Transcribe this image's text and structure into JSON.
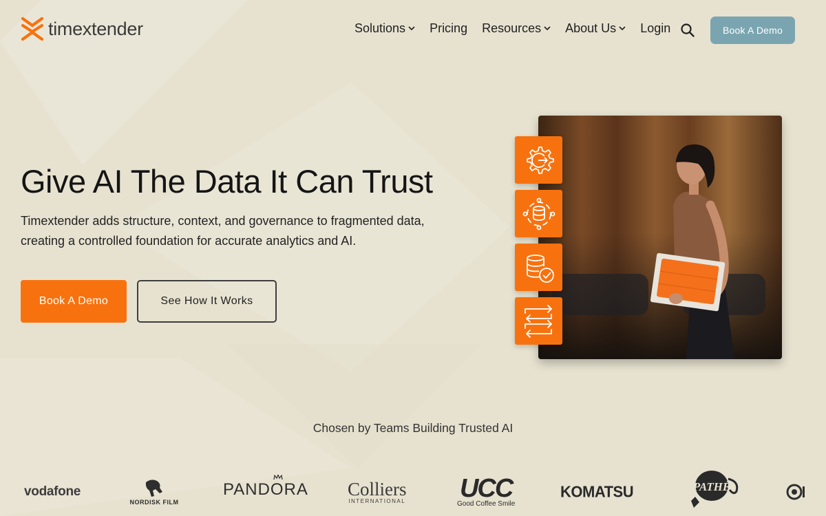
{
  "brand": {
    "logo_text": "timextender",
    "accent": "#f7720f",
    "secondary_button": "#7aa5b0"
  },
  "nav": {
    "items": [
      {
        "label": "Solutions",
        "dropdown": true
      },
      {
        "label": "Pricing",
        "dropdown": false
      },
      {
        "label": "Resources",
        "dropdown": true
      },
      {
        "label": "About Us",
        "dropdown": true
      },
      {
        "label": "Login",
        "dropdown": false
      }
    ],
    "search_icon": "search-icon",
    "cta_label": "Book A Demo"
  },
  "hero": {
    "title": "Give AI The Data It Can Trust",
    "subtitle_line1": "Timextender adds structure, context, and governance to fragmented data,",
    "subtitle_line2": "creating a controlled foundation for accurate analytics and AI.",
    "primary_label": "Book A Demo",
    "secondary_label": "See How It Works"
  },
  "feature_icons": [
    "gear-arrow-icon",
    "database-circle-icon",
    "database-check-icon",
    "swap-arrows-icon"
  ],
  "trusted": {
    "heading": "Chosen by Teams Building Trusted AI",
    "logos": [
      {
        "name": "vodafone",
        "text": "vodafone"
      },
      {
        "name": "nordisk-film",
        "text": "NORDISK FILM"
      },
      {
        "name": "pandora",
        "text": "PANDORA"
      },
      {
        "name": "colliers",
        "text": "Colliers",
        "sub": "INTERNATIONAL"
      },
      {
        "name": "ucc",
        "text": "UCC",
        "sub": "Good Coffee Smile"
      },
      {
        "name": "komatsu",
        "text": "KOMATSU"
      },
      {
        "name": "pathe",
        "text": "PATHÉ"
      }
    ]
  }
}
